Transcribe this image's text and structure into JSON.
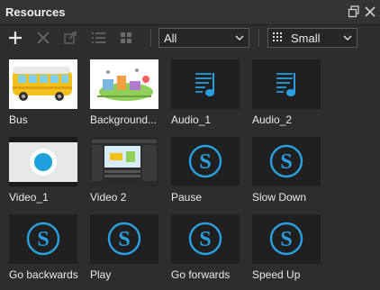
{
  "panel": {
    "title": "Resources"
  },
  "toolbar": {
    "filter_value": "All",
    "size_value": "Small"
  },
  "colors": {
    "accent": "#2aa0e0",
    "panel_bg": "#2d2d2d",
    "thumb_bg": "#202020"
  },
  "resources": [
    {
      "label": "Bus",
      "kind": "image-bus"
    },
    {
      "label": "Background...",
      "kind": "image-background"
    },
    {
      "label": "Audio_1",
      "kind": "audio"
    },
    {
      "label": "Audio_2",
      "kind": "audio"
    },
    {
      "label": "Video_1",
      "kind": "video-dot"
    },
    {
      "label": "Video 2",
      "kind": "video-screen"
    },
    {
      "label": "Pause",
      "kind": "script"
    },
    {
      "label": "Slow Down",
      "kind": "script"
    },
    {
      "label": "Go backwards",
      "kind": "script"
    },
    {
      "label": "Play",
      "kind": "script"
    },
    {
      "label": "Go forwards",
      "kind": "script"
    },
    {
      "label": "Speed Up",
      "kind": "script"
    }
  ]
}
